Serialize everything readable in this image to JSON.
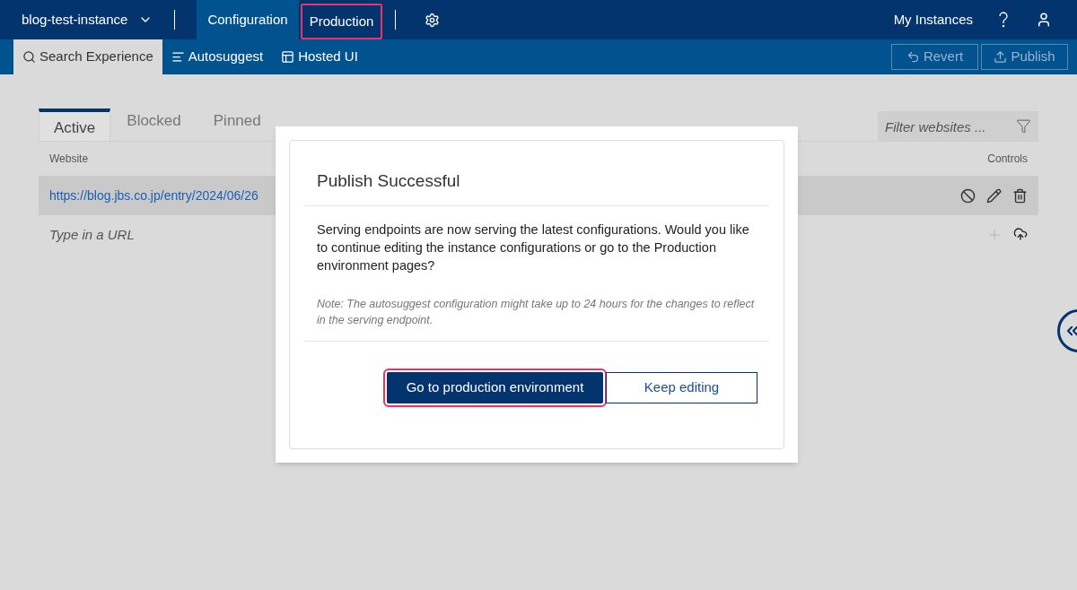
{
  "top_bar": {
    "instance": "blog-test-instance",
    "nav": [
      {
        "label": "Configuration",
        "selected": true,
        "highlighted": false
      },
      {
        "label": "Production",
        "selected": false,
        "highlighted": true
      }
    ],
    "right_links": [
      "My Instances"
    ]
  },
  "sub_bar": {
    "tabs": [
      {
        "label": "Search Experience",
        "selected": true
      },
      {
        "label": "Autosuggest",
        "selected": false
      },
      {
        "label": "Hosted UI",
        "selected": false
      }
    ],
    "actions": [
      {
        "label": "Revert",
        "disabled": true
      },
      {
        "label": "Publish",
        "disabled": true
      }
    ]
  },
  "list_tabs": [
    {
      "label": "Active",
      "selected": true
    },
    {
      "label": "Blocked",
      "selected": false
    },
    {
      "label": "Pinned",
      "selected": false
    }
  ],
  "filter": {
    "placeholder": "Filter websites ..."
  },
  "table": {
    "columns": [
      "Website",
      "Controls"
    ],
    "rows": [
      {
        "url": "https://blog.jbs.co.jp/entry/2024/06/26",
        "selected": true
      }
    ],
    "new_row": {
      "placeholder": "Type in a URL"
    }
  },
  "dialog": {
    "title": "Publish Successful",
    "message": "Serving endpoints are now serving the latest configurations. Would you like to continue editing the instance configurations or go to the Production environment pages?",
    "note": "Note: The autosuggest configuration might take up to 24 hours for the changes to reflect in the serving endpoint.",
    "buttons": [
      {
        "label": "Go to production environment",
        "kind": "primary",
        "highlighted": true
      },
      {
        "label": "Keep editing",
        "kind": "secondary",
        "highlighted": false
      }
    ]
  }
}
